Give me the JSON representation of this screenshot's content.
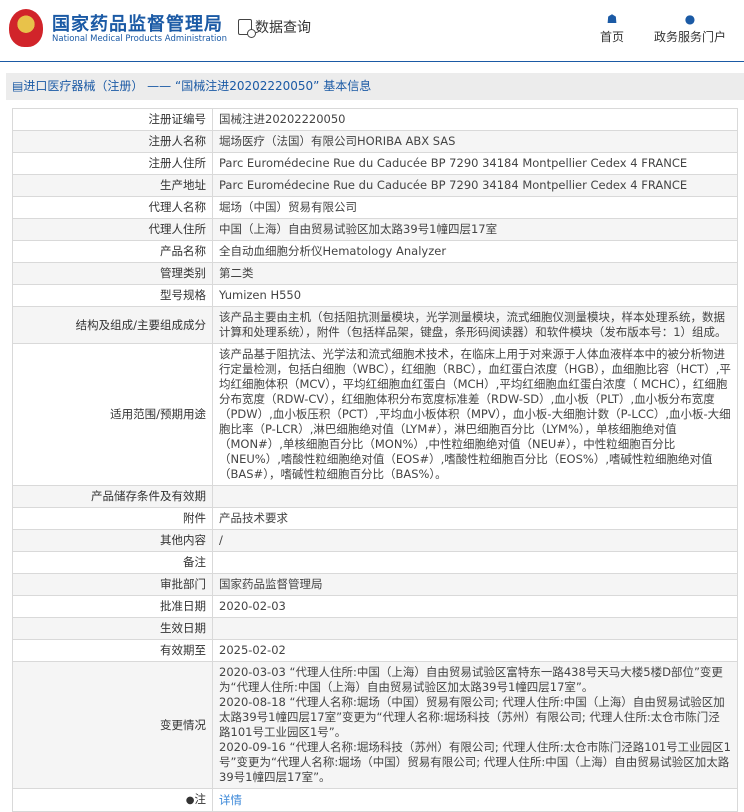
{
  "header": {
    "logo_cn": "国家药品监督管理局",
    "logo_en": "National Medical Products Administration",
    "data_query": "数据查询",
    "nav": [
      {
        "label": "首页",
        "icon": "home-icon"
      },
      {
        "label": "政务服务门户",
        "icon": "user-icon"
      }
    ]
  },
  "title": "进口医疗器械（注册） —— “国械注进20202220050” 基本信息",
  "rows": [
    {
      "label": "注册证编号",
      "value": "国械注进20202220050"
    },
    {
      "label": "注册人名称",
      "value": "堀场医疗（法国）有限公司HORIBA ABX SAS"
    },
    {
      "label": "注册人住所",
      "value": "Parc Euromédecine Rue du Caducée BP 7290 34184 Montpellier Cedex 4 FRANCE"
    },
    {
      "label": "生产地址",
      "value": "Parc Euromédecine Rue du Caducée BP 7290 34184 Montpellier Cedex 4 FRANCE"
    },
    {
      "label": "代理人名称",
      "value": "堀场（中国）贸易有限公司"
    },
    {
      "label": "代理人住所",
      "value": "中国（上海）自由贸易试验区加太路39号1幢四层17室"
    },
    {
      "label": "产品名称",
      "value": "全自动血细胞分析仪Hematology Analyzer"
    },
    {
      "label": "管理类别",
      "value": "第二类"
    },
    {
      "label": "型号规格",
      "value": "Yumizen H550"
    },
    {
      "label": "结构及组成/主要组成成分",
      "value": "该产品主要由主机（包括阻抗测量模块，光学测量模块，流式细胞仪测量模块，样本处理系统，数据计算和处理系统），附件（包括样品架，键盘，条形码阅读器）和软件模块（发布版本号：1）组成。"
    },
    {
      "label": "适用范围/预期用途",
      "value": "该产品基于阻抗法、光学法和流式细胞术技术，在临床上用于对来源于人体血液样本中的被分析物进行定量检测，包括白细胞（WBC），红细胞（RBC），血红蛋白浓度（HGB），血细胞比容（HCT）,平均红细胞体积（MCV），平均红细胞血红蛋白（MCH）,平均红细胞血红蛋白浓度（ MCHC），红细胞分布宽度（RDW-CV），红细胞体积分布宽度标准差（RDW-SD）,血小板（PLT）,血小板分布宽度（PDW）,血小板压积（PCT）,平均血小板体积（MPV），血小板-大细胞计数（P-LCC）,血小板-大细胞比率（P-LCR）,淋巴细胞绝对值（LYM#），淋巴细胞百分比（LYM%），单核细胞绝对值（MON#）,单核细胞百分比（MON%）,中性粒细胞绝对值（NEU#），中性粒细胞百分比（NEU%）,嗜酸性粒细胞绝对值（EOS#）,嗜酸性粒细胞百分比（EOS%）,嗜碱性粒细胞绝对值（BAS#），嗜碱性粒细胞百分比（BAS%）。"
    },
    {
      "label": "产品储存条件及有效期",
      "value": ""
    },
    {
      "label": "附件",
      "value": "产品技术要求"
    },
    {
      "label": "其他内容",
      "value": "/"
    },
    {
      "label": "备注",
      "value": ""
    },
    {
      "label": "审批部门",
      "value": "国家药品监督管理局"
    },
    {
      "label": "批准日期",
      "value": "2020-02-03"
    },
    {
      "label": "生效日期",
      "value": ""
    },
    {
      "label": "有效期至",
      "value": "2025-02-02"
    }
  ],
  "changes": {
    "label": "变更情况",
    "items": [
      "2020-03-03 “代理人住所:中国（上海）自由贸易试验区富特东一路438号天马大楼5楼D部位”变更为“代理人住所:中国（上海）自由贸易试验区加太路39号1幢四层17室”。",
      "2020-08-18 “代理人名称:堀场（中国）贸易有限公司; 代理人住所:中国（上海）自由贸易试验区加太路39号1幢四层17室”变更为“代理人名称:堀场科技（苏州）有限公司; 代理人住所:太仓市陈门泾路101号工业园区1号”。",
      "2020-09-16 “代理人名称:堀场科技（苏州）有限公司; 代理人住所:太仓市陈门泾路101号工业园区1号”变更为“代理人名称:堀场（中国）贸易有限公司; 代理人住所:中国（上海）自由贸易试验区加太路39号1幢四层17室”。"
    ]
  },
  "note": {
    "label": "注",
    "link": "详情"
  }
}
